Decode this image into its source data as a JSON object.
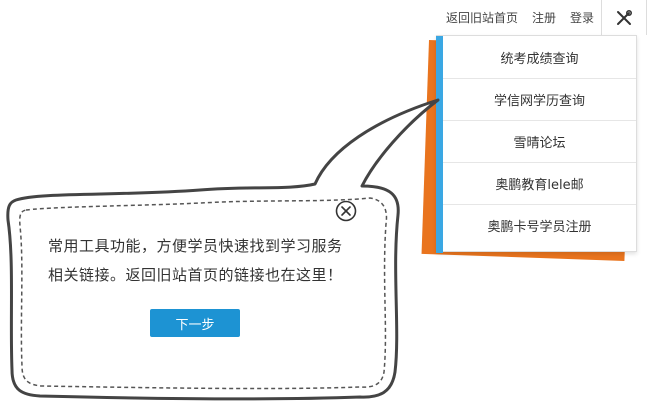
{
  "topnav": {
    "links": [
      "返回旧站首页",
      "注册",
      "登录"
    ],
    "tools_icon": "wrench-screwdriver-icon"
  },
  "menu": {
    "items": [
      "统考成绩查询",
      "学信网学历查询",
      "雪晴论坛",
      "奥鹏教育lele邮",
      "奥鹏卡号学员注册"
    ],
    "accent_color": "#3aa7e3",
    "shadow_color": "#e9741e"
  },
  "tooltip": {
    "text_line1": "常用工具功能，方便学员快速找到学习服务",
    "text_line2": "相关链接。返回旧站首页的链接也在这里！",
    "next_label": "下一步",
    "close_icon": "close-circle-icon",
    "button_color": "#1d93d3"
  }
}
